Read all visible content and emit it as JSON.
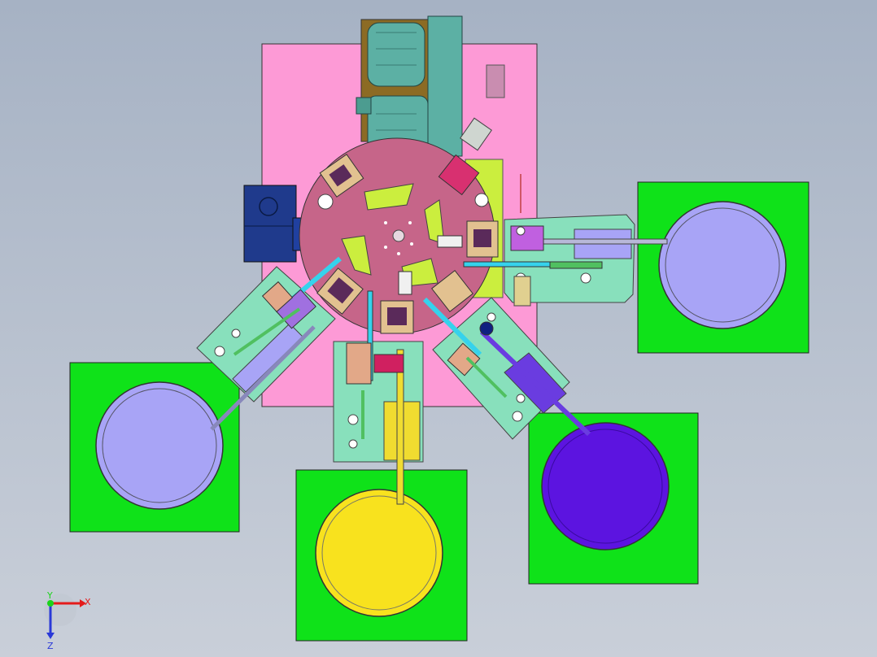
{
  "viewport": {
    "background_top": "#a6b2c4",
    "background_bottom": "#c9cfd9"
  },
  "triad": {
    "x_label": "X",
    "y_label": "Y",
    "z_label": "Z",
    "x_color": "#e41b1b",
    "y_color": "#1bd41b",
    "z_color": "#2a39d8"
  },
  "colors": {
    "base_plate": "#fd9ad6",
    "turntable": "#c66589",
    "turntable_window": "#cbee3e",
    "feeder_plate": "#88e0bc",
    "bowl_base": "#0fe219",
    "bowl_lavender": "#a8a4f6",
    "bowl_violet": "#5c14e0",
    "bowl_yellow": "#f8e21e",
    "motor": "#5cb0a4",
    "motor_mount": "#8c6b24",
    "blue_box": "#1f3a8c",
    "track_cyan": "#36d2ec",
    "track_violet": "#6a3ce0",
    "track_yellow": "#f0dc30"
  }
}
